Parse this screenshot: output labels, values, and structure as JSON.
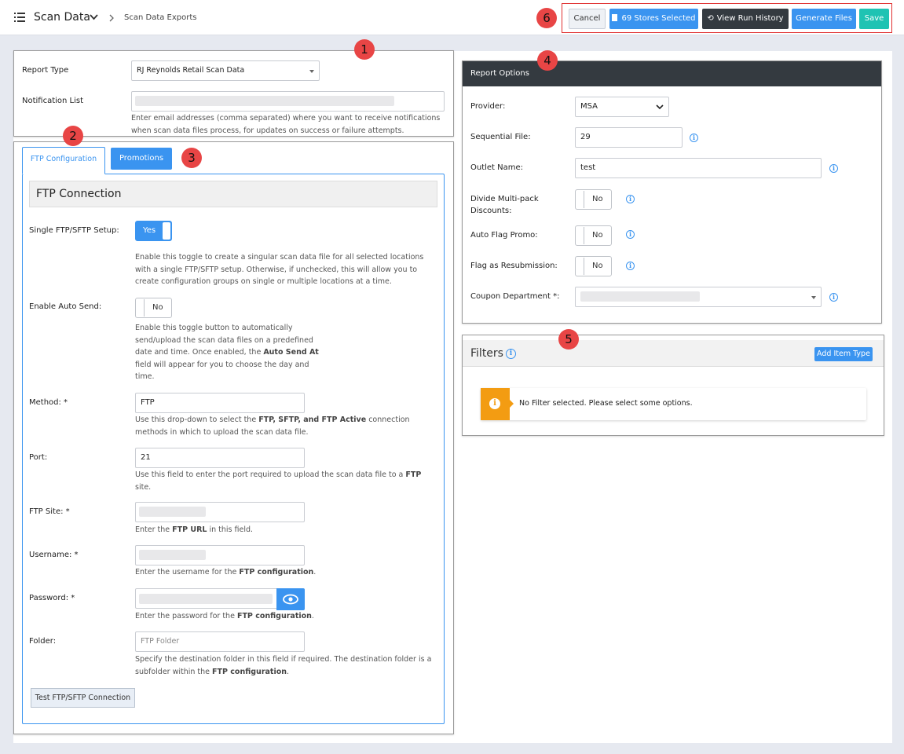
{
  "header": {
    "title": "Scan Data",
    "page": "Scan Data Exports",
    "buttons": {
      "cancel": "Cancel",
      "stores": "69 Stores Selected",
      "history": "View Run History",
      "generate": "Generate Files",
      "save": "Save"
    }
  },
  "badges": [
    "1",
    "2",
    "3",
    "4",
    "5",
    "6"
  ],
  "report": {
    "type_label": "Report Type",
    "type_value": "RJ Reynolds Retail Scan Data",
    "notify_label": "Notification List",
    "notify_help": "Enter email addresses (comma separated) where you want to receive notifications when scan data files process, for updates on success or failure attempts."
  },
  "tabs": {
    "ftp": "FTP Configuration",
    "promotions": "Promotions"
  },
  "ftp": {
    "section_title": "FTP Connection",
    "single_label": "Single FTP/SFTP Setup:",
    "single_value": "Yes",
    "single_help": "Enable this toggle to create a singular scan data file for all selected locations with a single FTP/SFTP setup. Otherwise, if unchecked, this will allow you to create configuration groups on single or multiple locations at a time.",
    "auto_label": "Enable Auto Send:",
    "auto_value": "No",
    "auto_help_1": "Enable this toggle button to automatically send/upload the scan data files on a predefined date and time. Once enabled, the ",
    "auto_help_bold": "Auto Send At",
    "auto_help_2": " field will appear for you to choose the day and time.",
    "method_label": "Method: *",
    "method_value": "FTP",
    "method_help_1": "Use this drop-down to select the ",
    "method_help_bold": "FTP, SFTP, and FTP Active",
    "method_help_2": " connection methods in which to upload the scan data file.",
    "port_label": "Port:",
    "port_value": "21",
    "port_help_1": "Use this field to enter the port required to upload the scan data file to a ",
    "port_help_bold": "FTP",
    "port_help_2": " site.",
    "site_label": "FTP Site: *",
    "site_help_1": "Enter the ",
    "site_help_bold": "FTP URL",
    "site_help_2": " in this field.",
    "user_label": "Username: *",
    "user_help_1": "Enter the username for the ",
    "user_help_bold": "FTP configuration",
    "user_help_2": ".",
    "pass_label": "Password: *",
    "pass_help_1": "Enter the password for the ",
    "pass_help_bold": "FTP configuration",
    "pass_help_2": ".",
    "folder_label": "Folder:",
    "folder_placeholder": "FTP Folder",
    "folder_help_1": "Specify the destination folder in this field if required. The destination folder is a subfolder within the ",
    "folder_help_bold": "FTP configuration",
    "folder_help_2": ".",
    "test_button": "Test FTP/SFTP Connection"
  },
  "options": {
    "title": "Report Options",
    "provider_label": "Provider:",
    "provider_value": "MSA",
    "seq_label": "Sequential File:",
    "seq_value": "29",
    "outlet_label": "Outlet Name:",
    "outlet_value": "test",
    "divide_label": "Divide Multi-pack Discounts:",
    "divide_value": "No",
    "autoflag_label": "Auto Flag Promo:",
    "autoflag_value": "No",
    "resub_label": "Flag as Resubmission:",
    "resub_value": "No",
    "coupon_label": "Coupon Department *:"
  },
  "filters": {
    "title": "Filters",
    "add_button": "Add Item Type",
    "empty_message": "No Filter selected. Please select some options."
  },
  "colors": {
    "accent": "#3a94f0",
    "dark": "#343a40",
    "teal": "#1fc3b3",
    "badge": "#e84545",
    "warning": "#f39c12"
  }
}
